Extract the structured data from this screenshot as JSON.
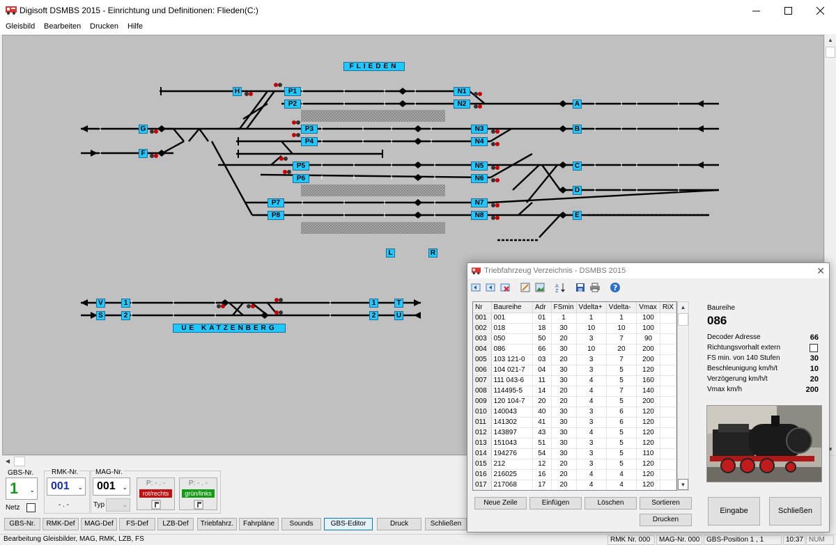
{
  "window": {
    "title": "Digisoft DSMBS 2015 - Einrichtung und Definitionen: Flieden(C:)",
    "menu": [
      "Gleisbild",
      "Bearbeiten",
      "Drucken",
      "Hilfe"
    ]
  },
  "track_labels": {
    "station": "FLIEDEN",
    "station2": "UE KATZENBERG",
    "H": "H",
    "G": "G",
    "F": "F",
    "P1": "P1",
    "P2": "P2",
    "P3": "P3",
    "P4": "P4",
    "P5": "P5",
    "P6": "P6",
    "P7": "P7",
    "P8": "P8",
    "N1": "N1",
    "N2": "N2",
    "N3": "N3",
    "N4": "N4",
    "N5": "N5",
    "N6": "N6",
    "N7": "N7",
    "N8": "N8",
    "A": "A",
    "B": "B",
    "C": "C",
    "D": "D",
    "E": "E",
    "L": "L",
    "R": "R",
    "V": "V",
    "S": "S",
    "one_a": "1",
    "two_a": "2",
    "one_b": "1",
    "two_b": "2",
    "T": "T",
    "U": "U"
  },
  "panel": {
    "gbs_label": "GBS-Nr.",
    "gbs_value": "1",
    "rmk_label": "RMK-Nr.",
    "rmk_value": "001",
    "rmk_sub": "- . -",
    "mag_label": "MAG-Nr.",
    "mag_value": "001",
    "netz_label": "Netz",
    "typ_label": "Typ",
    "sig1_p": "P: - . -",
    "sig1_state": "rot/rechts",
    "sig2_p": "P: - . -",
    "sig2_state": "grün/links"
  },
  "tabs": [
    "GBS-Nr.",
    "RMK-Def",
    "MAG-Def",
    "FS-Def",
    "LZB-Def",
    "Triebfahrz.",
    "Fahrpläne",
    "Sounds",
    "GBS-Editor",
    "Druck",
    "Schließen"
  ],
  "status": {
    "main": "Bearbeitung Gleisbilder, MAG, RMK, LZB, FS",
    "rmk": "RMK Nr. 000",
    "mag": "MAG-Nr. 000",
    "gbs_pos": "GBS-Position 1 , 1",
    "time": "10:37",
    "num": "NUM"
  },
  "dialog": {
    "title": "Triebfahrzeug Verzeichnis - DSMBS 2015",
    "columns": [
      "Nr",
      "Baureihe",
      "Adr",
      "FSmin",
      "Vdelta+",
      "Vdelta-",
      "Vmax",
      "RiX"
    ],
    "rows": [
      [
        "001",
        "001",
        "01",
        "1",
        "1",
        "1",
        "100"
      ],
      [
        "002",
        "018",
        "18",
        "30",
        "10",
        "10",
        "100"
      ],
      [
        "003",
        "050",
        "50",
        "20",
        "3",
        "7",
        "90"
      ],
      [
        "004",
        "086",
        "66",
        "30",
        "10",
        "20",
        "200"
      ],
      [
        "005",
        "103 121-0",
        "03",
        "20",
        "3",
        "7",
        "200"
      ],
      [
        "006",
        "104 021-7",
        "04",
        "30",
        "3",
        "5",
        "120"
      ],
      [
        "007",
        "111 043-6",
        "11",
        "30",
        "4",
        "5",
        "160"
      ],
      [
        "008",
        "114495-5",
        "14",
        "20",
        "4",
        "7",
        "140"
      ],
      [
        "009",
        "120 104-7",
        "20",
        "20",
        "4",
        "5",
        "200"
      ],
      [
        "010",
        "140043",
        "40",
        "30",
        "3",
        "6",
        "120"
      ],
      [
        "011",
        "141302",
        "41",
        "30",
        "3",
        "6",
        "120"
      ],
      [
        "012",
        "143897",
        "43",
        "30",
        "4",
        "5",
        "120"
      ],
      [
        "013",
        "151043",
        "51",
        "30",
        "3",
        "5",
        "120"
      ],
      [
        "014",
        "194276",
        "54",
        "30",
        "3",
        "5",
        "110"
      ],
      [
        "015",
        "212",
        "12",
        "20",
        "3",
        "5",
        "120"
      ],
      [
        "016",
        "216025",
        "16",
        "20",
        "4",
        "4",
        "120"
      ],
      [
        "017",
        "217068",
        "17",
        "20",
        "4",
        "4",
        "120"
      ]
    ],
    "buttons": {
      "neue_zeile": "Neue Zeile",
      "einfuegen": "Einfügen",
      "loeschen": "Löschen",
      "sortieren": "Sortieren",
      "drucken": "Drucken",
      "eingabe": "Eingabe",
      "schliessen": "Schließen"
    },
    "detail": {
      "baureihe_label": "Baureihe",
      "baureihe_value": "086",
      "decoder_label": "Decoder Adresse",
      "decoder_value": "66",
      "richtung_label": "Richtungsvorhalt extern",
      "fsmin_label": "FS min. von 140 Stufen",
      "fsmin_value": "30",
      "beschl_label": "Beschleunigung km/h/t",
      "beschl_value": "10",
      "verz_label": "Verzögerung  km/h/t",
      "verz_value": "20",
      "vmax_label": "Vmax km/h",
      "vmax_value": "200"
    }
  }
}
